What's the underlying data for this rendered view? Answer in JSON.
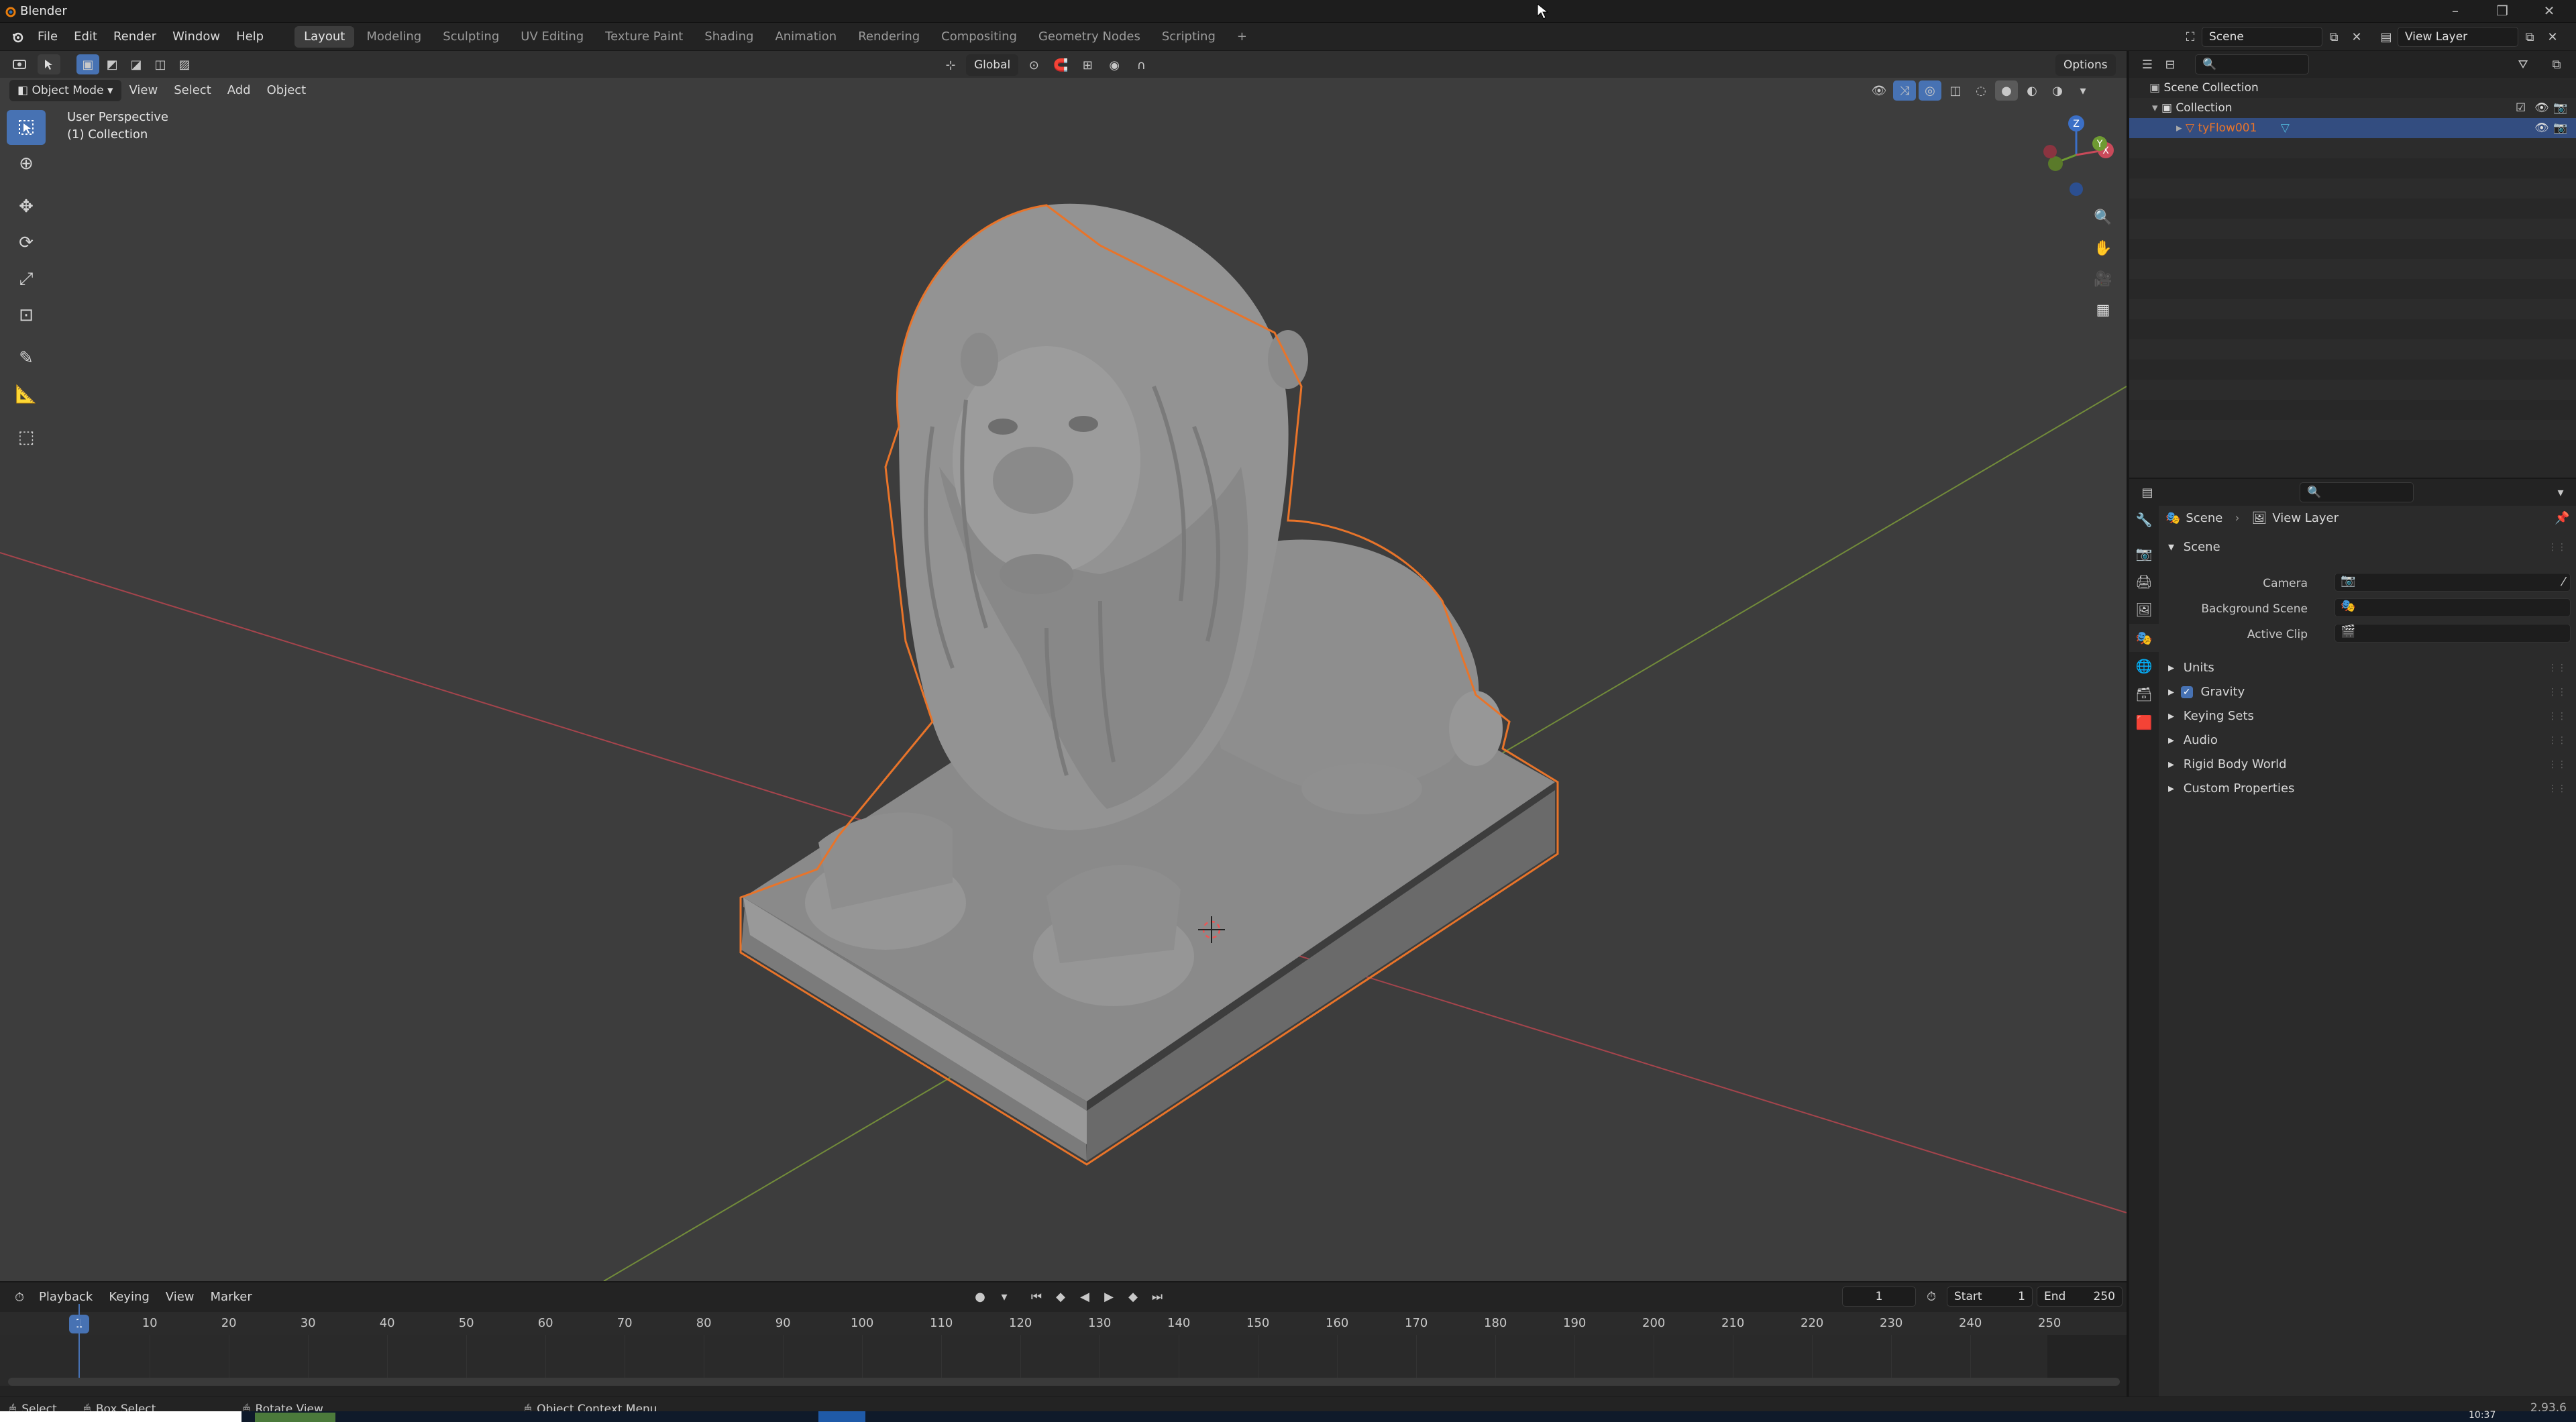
{
  "window": {
    "title": "Blender",
    "minimize": "–",
    "maximize": "❐",
    "close": "✕"
  },
  "menubar": {
    "menus": [
      "File",
      "Edit",
      "Render",
      "Window",
      "Help"
    ],
    "workspaces": [
      "Layout",
      "Modeling",
      "Sculpting",
      "UV Editing",
      "Texture Paint",
      "Shading",
      "Animation",
      "Rendering",
      "Compositing",
      "Geometry Nodes",
      "Scripting"
    ],
    "active_workspace": "Layout",
    "add_tab": "+",
    "scene_label": "Scene",
    "view_layer_label": "View Layer"
  },
  "viewport": {
    "mode": "Object Mode",
    "menus": [
      "View",
      "Select",
      "Add",
      "Object"
    ],
    "transform_orientation": "Global",
    "options": "Options",
    "info_line1": "User Perspective",
    "info_line2": "(1) Collection",
    "gizmo_axes": {
      "x": "X",
      "y": "Y",
      "z": "Z"
    }
  },
  "timeline": {
    "menus": [
      "Playback",
      "Keying",
      "View",
      "Marker"
    ],
    "current_frame": "1",
    "start_label": "Start",
    "start_value": "1",
    "end_label": "End",
    "end_value": "250",
    "ruler": [
      "10",
      "20",
      "30",
      "40",
      "50",
      "60",
      "70",
      "80",
      "90",
      "100",
      "110",
      "120",
      "130",
      "140",
      "150",
      "160",
      "170",
      "180",
      "190",
      "200",
      "210",
      "220",
      "230",
      "240",
      "250"
    ],
    "playhead": "1"
  },
  "statusbar": {
    "select": "Select",
    "box_select": "Box Select",
    "rotate_view": "Rotate View",
    "context_menu": "Object Context Menu",
    "version": "2.93.6",
    "clock": "10:37"
  },
  "outliner": {
    "scene_collection": "Scene Collection",
    "collection": "Collection",
    "object": "tyFlow001"
  },
  "properties": {
    "breadcrumb_scene": "Scene",
    "breadcrumb_view_layer": "View Layer",
    "panel_title": "Scene",
    "camera_label": "Camera",
    "background_scene_label": "Background Scene",
    "active_clip_label": "Active Clip",
    "panels": [
      "Units",
      "Gravity",
      "Keying Sets",
      "Audio",
      "Rigid Body World",
      "Custom Properties"
    ],
    "gravity_checked": true
  },
  "colors": {
    "accent": "#4772b3",
    "selection_outline": "#e8742a",
    "x_axis": "#c4394b",
    "y_axis": "#8cae35",
    "viewport_bg": "#3d3d3d"
  }
}
